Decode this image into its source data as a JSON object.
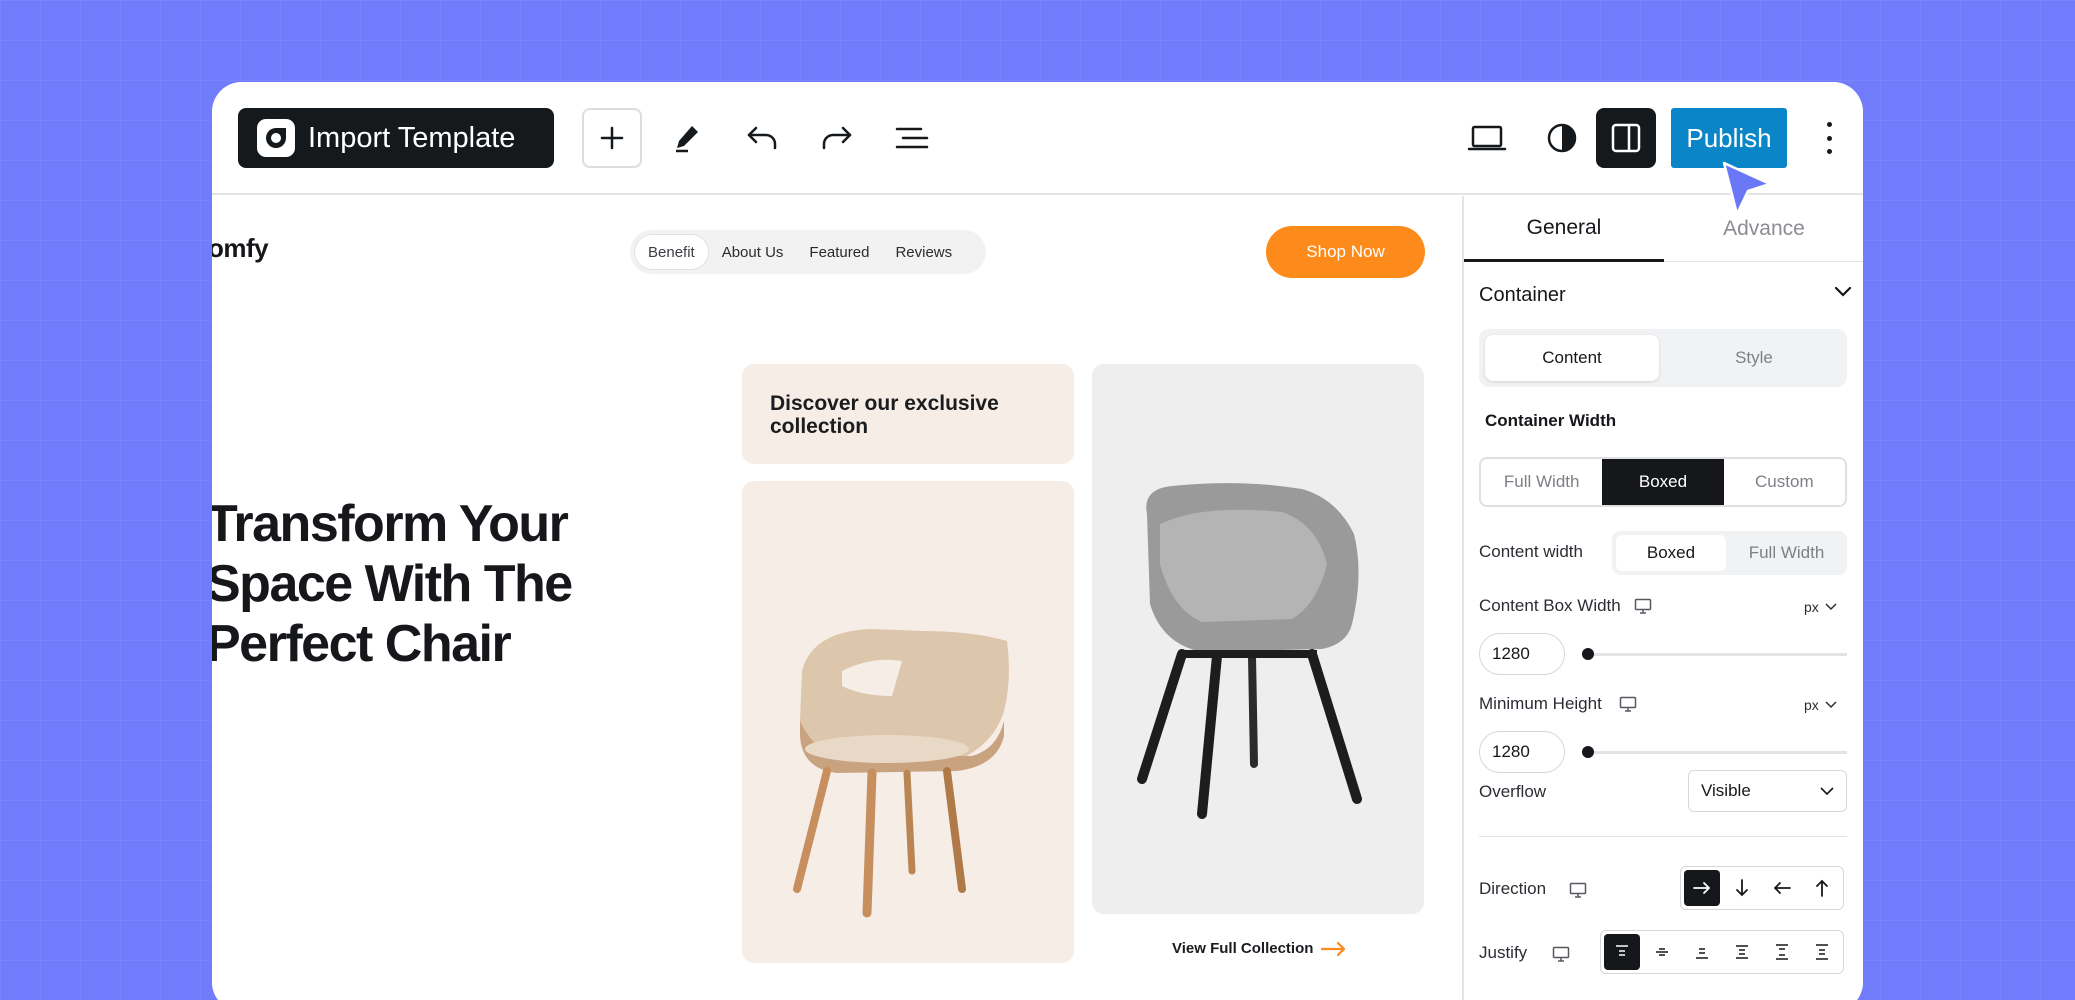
{
  "toolbar": {
    "import_label": "Import Template",
    "publish_label": "Publish",
    "icons": [
      "plus-icon",
      "pen-icon",
      "undo-icon",
      "redo-icon",
      "list-icon",
      "laptop-icon",
      "contrast-icon",
      "panel-toggle-icon",
      "more-icon"
    ]
  },
  "canvas": {
    "logo": "omfy",
    "nav": [
      "Benefit",
      "About Us",
      "Featured",
      "Reviews"
    ],
    "shop_label": "Shop Now",
    "hero_lines": [
      "Transform Your",
      "Space With The",
      "Perfect Chair"
    ],
    "card_text_1": "Discover our exclusive",
    "card_text_2": "collection",
    "view_link": "View Full Collection"
  },
  "panel": {
    "tab_general": "General",
    "tab_advance": "Advance",
    "section_title": "Container",
    "seg_content": "Content",
    "seg_style": "Style",
    "container_width_label": "Container Width",
    "cw_options": [
      "Full Width",
      "Boxed",
      "Custom"
    ],
    "content_width_label": "Content width",
    "content_width_options": [
      "Boxed",
      "Full Width"
    ],
    "content_box_width_label": "Content Box Width",
    "content_box_width_value": "1280",
    "min_height_label": "Minimum Height",
    "min_height_value": "1280",
    "unit": "px",
    "overflow_label": "Overflow",
    "overflow_value": "Visible",
    "direction_label": "Direction",
    "justify_label": "Justify"
  },
  "colors": {
    "background": "#717cfc",
    "publish": "#0a86c8",
    "shop": "#fd8b1c",
    "dark": "#15171a",
    "card_beige": "#f5ede6",
    "card_gray": "#eeeeee"
  }
}
